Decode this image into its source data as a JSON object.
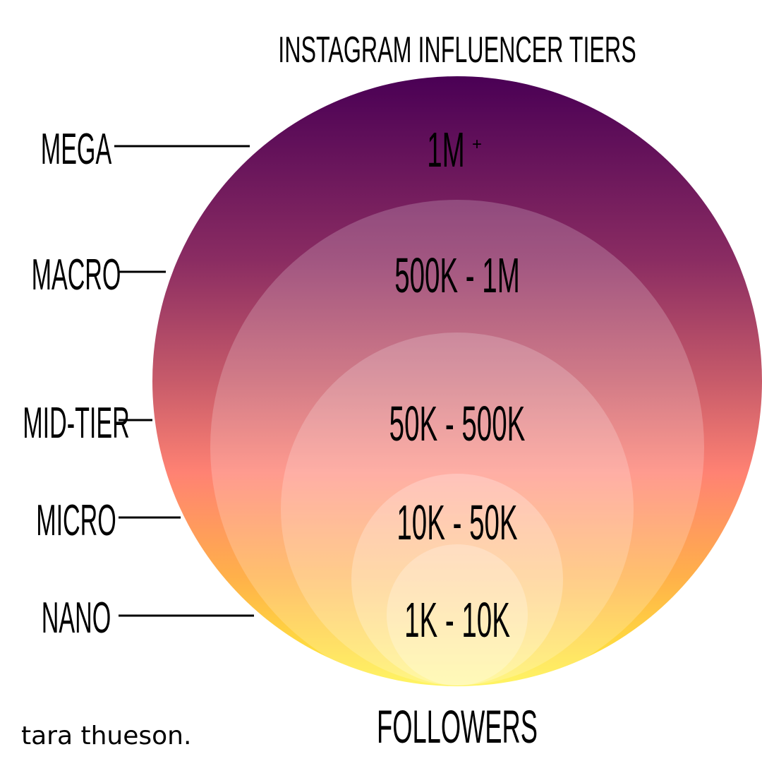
{
  "title": "INSTAGRAM INFLUENCER TIERS",
  "footer_label": "FOLLOWERS",
  "brand": "tara thueson.",
  "tiers": [
    {
      "name": "MEGA",
      "range": "1M",
      "range_suffix": "+"
    },
    {
      "name": "MACRO",
      "range": "500K - 1M"
    },
    {
      "name": "MID-TIER",
      "range": "50K - 500K"
    },
    {
      "name": "MICRO",
      "range": "10K - 50K"
    },
    {
      "name": "NANO",
      "range": "1K - 10K"
    }
  ],
  "colors": {
    "gradient": [
      "#4a0055",
      "#8a2c62",
      "#c75b6a",
      "#ff8273",
      "#ffb04a",
      "#fff23a"
    ],
    "text": "#000000"
  }
}
